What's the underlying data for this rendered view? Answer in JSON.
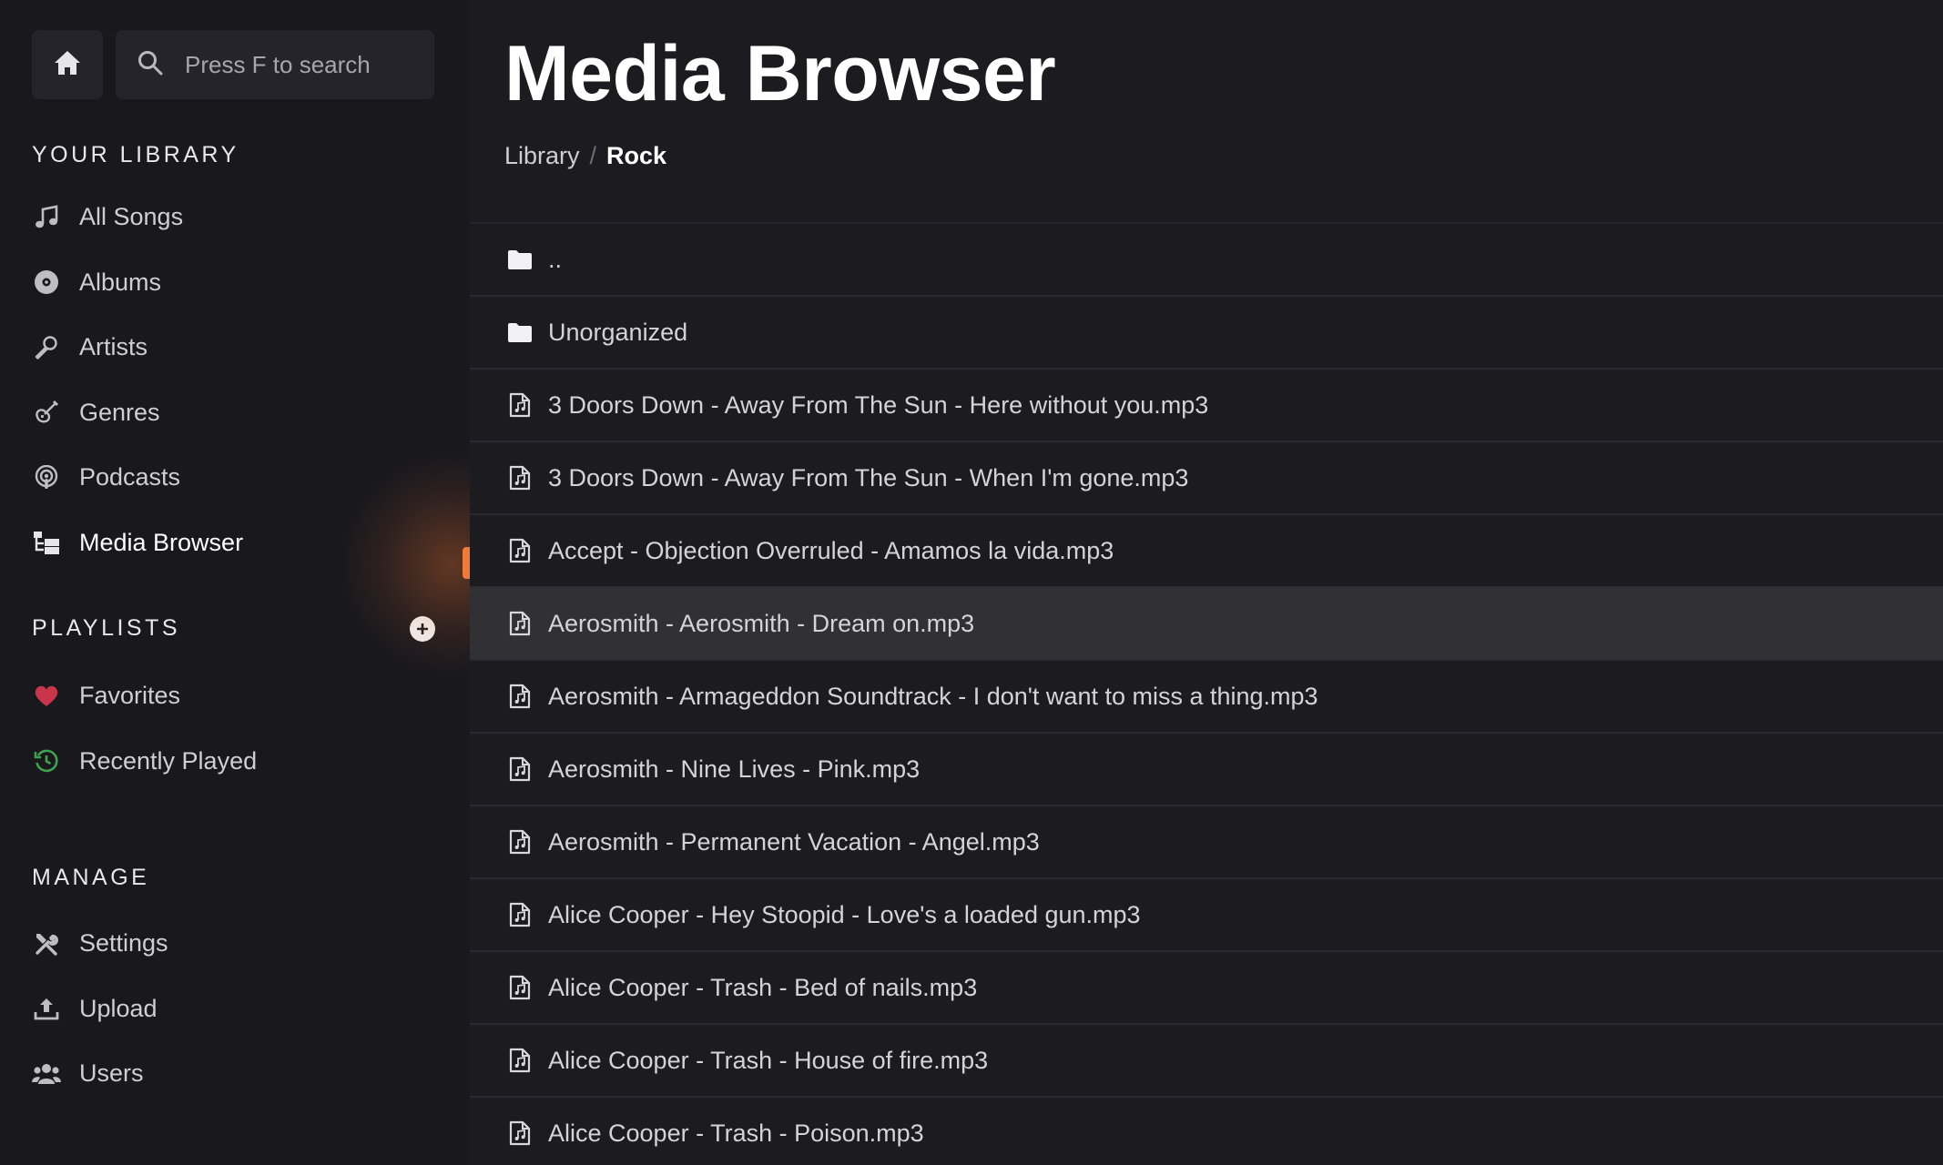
{
  "search": {
    "placeholder": "Press F to search"
  },
  "library": {
    "title": "YOUR LIBRARY",
    "items": [
      {
        "label": "All Songs",
        "icon": "music-note-icon"
      },
      {
        "label": "Albums",
        "icon": "disc-icon"
      },
      {
        "label": "Artists",
        "icon": "microphone-icon"
      },
      {
        "label": "Genres",
        "icon": "guitar-icon"
      },
      {
        "label": "Podcasts",
        "icon": "podcast-icon"
      },
      {
        "label": "Media Browser",
        "icon": "folder-tree-icon",
        "active": true
      }
    ]
  },
  "playlists": {
    "title": "PLAYLISTS",
    "items": [
      {
        "label": "Favorites",
        "icon": "heart-icon",
        "color": "#c9354a"
      },
      {
        "label": "Recently Played",
        "icon": "history-icon",
        "color": "#3fa34d"
      }
    ]
  },
  "manage": {
    "title": "MANAGE",
    "items": [
      {
        "label": "Settings",
        "icon": "tools-icon"
      },
      {
        "label": "Upload",
        "icon": "upload-icon"
      },
      {
        "label": "Users",
        "icon": "users-icon"
      }
    ]
  },
  "main": {
    "title": "Media Browser",
    "breadcrumb": {
      "parent": "Library",
      "separator": "/",
      "current": "Rock"
    },
    "rows": [
      {
        "name": "..",
        "type": "folder"
      },
      {
        "name": "Unorganized",
        "type": "folder"
      },
      {
        "name": "3 Doors Down - Away From The Sun - Here without you.mp3",
        "type": "file"
      },
      {
        "name": "3 Doors Down - Away From The Sun - When I'm gone.mp3",
        "type": "file"
      },
      {
        "name": "Accept - Objection Overruled - Amamos la vida.mp3",
        "type": "file"
      },
      {
        "name": "Aerosmith - Aerosmith - Dream on.mp3",
        "type": "file",
        "selected": true
      },
      {
        "name": "Aerosmith - Armageddon Soundtrack - I don't want to miss a thing.mp3",
        "type": "file"
      },
      {
        "name": "Aerosmith - Nine Lives - Pink.mp3",
        "type": "file"
      },
      {
        "name": "Aerosmith - Permanent Vacation - Angel.mp3",
        "type": "file"
      },
      {
        "name": "Alice Cooper - Hey Stoopid - Love's a loaded gun.mp3",
        "type": "file"
      },
      {
        "name": "Alice Cooper - Trash - Bed of nails.mp3",
        "type": "file"
      },
      {
        "name": "Alice Cooper - Trash - House of fire.mp3",
        "type": "file"
      },
      {
        "name": "Alice Cooper - Trash - Poison.mp3",
        "type": "file"
      }
    ]
  },
  "colors": {
    "accent": "#f07a3a",
    "selected_row": "#303035"
  }
}
